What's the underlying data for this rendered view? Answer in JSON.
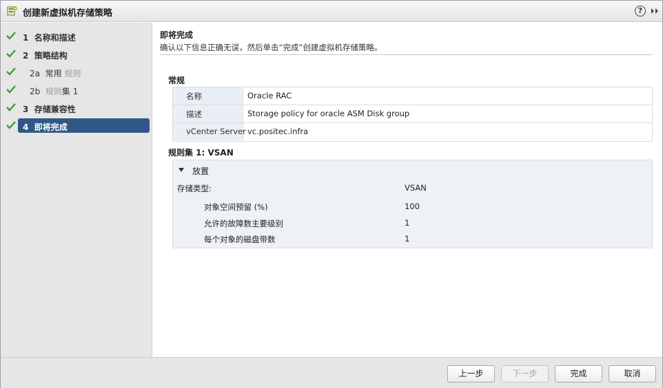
{
  "window": {
    "title": "创建新虚拟机存储策略",
    "help_label": "?"
  },
  "sidebar": {
    "steps": [
      {
        "number": "1",
        "label": "名称和描述",
        "completed": true
      },
      {
        "number": "2",
        "label": "策略结构",
        "completed": true
      },
      {
        "number": "2a",
        "label_prefix": "常用",
        "label_suffix": "规则",
        "completed": true
      },
      {
        "number": "2b",
        "label_prefix": "规则",
        "label_suffix": "集 1",
        "completed": true
      },
      {
        "number": "3",
        "label": "存储兼容性",
        "completed": true
      },
      {
        "number": "4",
        "label": "即将完成",
        "completed": true,
        "active": true
      }
    ]
  },
  "main": {
    "title": "即将完成",
    "description": "确认以下信息正确无误，然后单击“完成”创建虚拟机存储策略。",
    "general": {
      "title": "常规",
      "rows": [
        {
          "key": "名称",
          "value": "Oracle RAC"
        },
        {
          "key": "描述",
          "value": "Storage policy for oracle ASM Disk group"
        },
        {
          "key": "vCenter Server",
          "value": "vc.positec.infra"
        }
      ]
    },
    "ruleset": {
      "title": "规则集 1: VSAN",
      "section_label": "放置",
      "storage_type_label": "存储类型:",
      "storage_type_value": "VSAN",
      "rules": [
        {
          "name": "对象空间预留 (%)",
          "value": "100"
        },
        {
          "name": "允许的故障数主要级别",
          "value": "1"
        },
        {
          "name": "每个对象的磁盘带数",
          "value": "1"
        }
      ]
    }
  },
  "footer": {
    "back": "上一步",
    "next": "下一步",
    "finish": "完成",
    "cancel": "取消"
  },
  "colors": {
    "active_step": "#2f5886",
    "check": "#3c9a3c",
    "table_key_bg": "#e9eff4"
  }
}
